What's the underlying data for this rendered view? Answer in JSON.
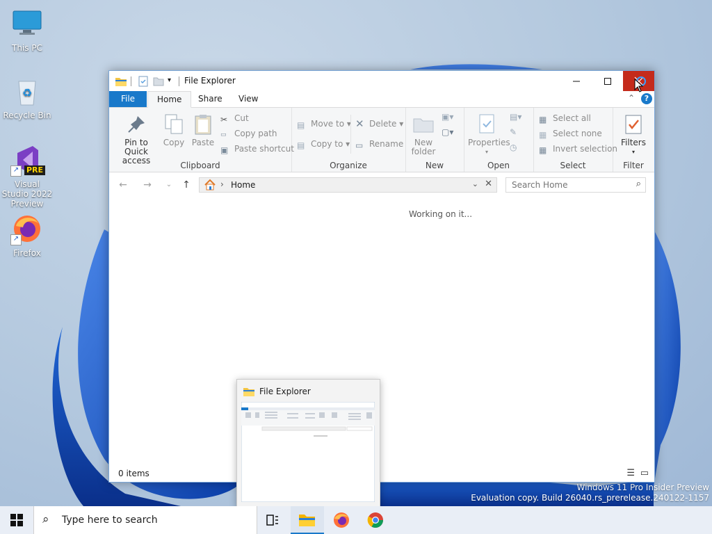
{
  "desktop": {
    "icons": [
      {
        "label": "This PC"
      },
      {
        "label": "Recycle Bin"
      },
      {
        "label": "Visual Studio 2022 Preview",
        "badge": "PRE"
      },
      {
        "label": "Firefox"
      }
    ],
    "watermark": {
      "line1": "Windows 11 Pro Insider Preview",
      "line2": "Evaluation copy. Build 26040.rs_prerelease.240122-1157"
    }
  },
  "window": {
    "title": "File Explorer",
    "tabs": {
      "file": "File",
      "home": "Home",
      "share": "Share",
      "view": "View"
    },
    "ribbon": {
      "clipboard": {
        "pin": "Pin to Quick access",
        "copy": "Copy",
        "paste": "Paste",
        "cut": "Cut",
        "copy_path": "Copy path",
        "paste_shortcut": "Paste shortcut",
        "group": "Clipboard"
      },
      "organize": {
        "move_to": "Move to",
        "copy_to": "Copy to",
        "delete": "Delete",
        "rename": "Rename",
        "group": "Organize"
      },
      "new": {
        "new_folder": "New folder",
        "group": "New"
      },
      "open": {
        "properties": "Properties",
        "group": "Open"
      },
      "select": {
        "select_all": "Select all",
        "select_none": "Select none",
        "invert": "Invert selection",
        "group": "Select"
      },
      "filter": {
        "filters": "Filters",
        "group": "Filter"
      }
    },
    "address": {
      "breadcrumb_sep": "›",
      "location": "Home"
    },
    "search": {
      "placeholder": "Search Home"
    },
    "content": {
      "message": "Working on it..."
    },
    "status": {
      "items": "0 items"
    }
  },
  "taskbar": {
    "search_placeholder": "Type here to search",
    "thumbnail_title": "File Explorer"
  },
  "colors": {
    "accent": "#1979ca",
    "close": "#c42b1c",
    "taskbar": "#e9eef6"
  }
}
